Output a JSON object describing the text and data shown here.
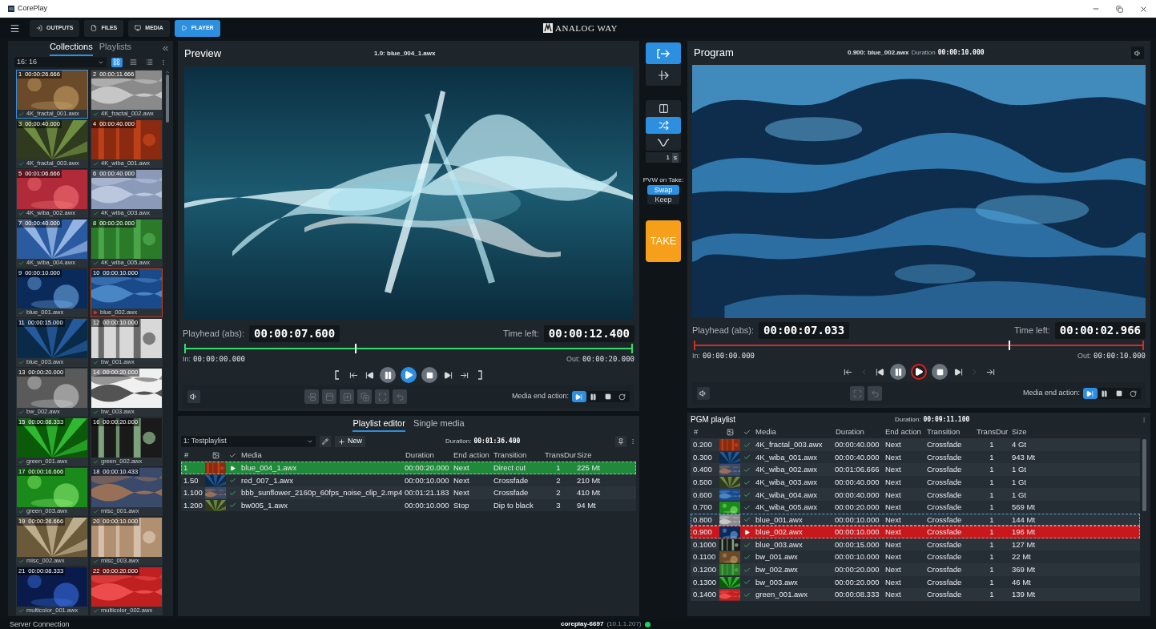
{
  "window": {
    "title": "CorePlay"
  },
  "toolbar": {
    "tabs": [
      {
        "label": "OUTPUTS",
        "kind": "outputs",
        "selected": false
      },
      {
        "label": "FILES",
        "kind": "files",
        "selected": false
      },
      {
        "label": "MEDIA",
        "kind": "media",
        "selected": false
      },
      {
        "label": "PLAYER",
        "kind": "player",
        "selected": true
      }
    ],
    "logo": "ANALOG WAY"
  },
  "library": {
    "tabs": [
      {
        "label": "Collections",
        "selected": true
      },
      {
        "label": "Playlists",
        "selected": false
      }
    ],
    "aspect": "16: 16",
    "views": [
      {
        "kind": "grid",
        "selected": true
      },
      {
        "kind": "list",
        "selected": false
      },
      {
        "kind": "details",
        "selected": false
      }
    ],
    "items": [
      {
        "number": "1",
        "time": "00:00:26.666",
        "name": "4K_fractal_001.awx",
        "selected": true,
        "playing": false
      },
      {
        "number": "2",
        "time": "00:00:11.666",
        "name": "4K_fractal_002.awx",
        "selected": false,
        "playing": false
      },
      {
        "number": "3",
        "time": "00:00:40.000",
        "name": "4K_fractal_003.awx",
        "selected": false,
        "playing": false
      },
      {
        "number": "4",
        "time": "00:00:40.000",
        "name": "4K_wiba_001.awx",
        "selected": false,
        "playing": false
      },
      {
        "number": "5",
        "time": "00:01:06.666",
        "name": "4K_wiba_002.awx",
        "selected": false,
        "playing": false
      },
      {
        "number": "6",
        "time": "00:00:40.000",
        "name": "4K_wiba_003.awx",
        "selected": false,
        "playing": false
      },
      {
        "number": "7",
        "time": "00:00:40.000",
        "name": "4K_wiba_004.awx",
        "selected": false,
        "playing": false
      },
      {
        "number": "8",
        "time": "00:00:20.000",
        "name": "4K_wiba_005.awx",
        "selected": false,
        "playing": false
      },
      {
        "number": "9",
        "time": "00:00:10.000",
        "name": "blue_001.awx",
        "selected": false,
        "playing": false
      },
      {
        "number": "10",
        "time": "00:00:10.000",
        "name": "blue_002.awx",
        "selected": false,
        "playing": true
      },
      {
        "number": "11",
        "time": "00:00:15.000",
        "name": "blue_003.awx",
        "selected": false,
        "playing": false
      },
      {
        "number": "12",
        "time": "00:00:10.000",
        "name": "bw_001.awx",
        "selected": false,
        "playing": false
      },
      {
        "number": "13",
        "time": "00:00:20.000",
        "name": "bw_002.awx",
        "selected": false,
        "playing": false
      },
      {
        "number": "14",
        "time": "00:00:20.000",
        "name": "bw_003.awx",
        "selected": false,
        "playing": false
      },
      {
        "number": "15",
        "time": "00:00:08.333",
        "name": "green_001.awx",
        "selected": false,
        "playing": false
      },
      {
        "number": "16",
        "time": "00:00:20.000",
        "name": "green_002.awx",
        "selected": false,
        "playing": false
      },
      {
        "number": "17",
        "time": "00:00:16.666",
        "name": "green_003.awx",
        "selected": false,
        "playing": false
      },
      {
        "number": "18",
        "time": "00:00:10.433",
        "name": "misc_001.awx",
        "selected": false,
        "playing": false
      },
      {
        "number": "19",
        "time": "00:00:26.666",
        "name": "misc_002.awx",
        "selected": false,
        "playing": false
      },
      {
        "number": "20",
        "time": "00:00:10.000",
        "name": "misc_003.awx",
        "selected": false,
        "playing": false
      },
      {
        "number": "21",
        "time": "00:00:08.333",
        "name": "multicolor_001.awx",
        "selected": false,
        "playing": false
      },
      {
        "number": "22",
        "time": "00:00:20.000",
        "name": "multicolor_002.awx",
        "selected": false,
        "playing": false
      }
    ]
  },
  "preview": {
    "kind": "preview",
    "title": "Preview",
    "clip": "1.0: blue_004_1.awx",
    "playhead_label": "Playhead (abs):",
    "playhead": "00:00:07.600",
    "time_left_label": "Time left:",
    "time_left": "00:00:12.400",
    "level": 0.38,
    "in_label": "In:",
    "in": "00:00:00.000",
    "out_label": "Out:",
    "out": "00:00:20.000",
    "transport": [
      {
        "kind": "mark-in",
        "disabled": false
      },
      {
        "kind": "go-start",
        "disabled": false
      },
      {
        "kind": "prev",
        "disabled": false
      },
      {
        "kind": "pause",
        "active": false
      },
      {
        "kind": "play",
        "active": true
      },
      {
        "kind": "stop",
        "active": false
      },
      {
        "kind": "next",
        "disabled": false
      },
      {
        "kind": "go-end",
        "disabled": false
      },
      {
        "kind": "mark-out",
        "disabled": false
      }
    ],
    "tools": [
      {
        "kind": "insert",
        "disabled": true
      },
      {
        "kind": "overlay",
        "disabled": true
      },
      {
        "kind": "append",
        "disabled": true
      },
      {
        "kind": "prepend",
        "disabled": true
      },
      {
        "kind": "fullscreen",
        "disabled": true
      },
      {
        "kind": "undo",
        "disabled": true
      }
    ],
    "end_action": {
      "label": "Media end action:",
      "options": [
        {
          "kind": "next",
          "selected": true
        },
        {
          "kind": "pause",
          "selected": false
        },
        {
          "kind": "stop",
          "selected": false
        },
        {
          "kind": "loop",
          "selected": false
        }
      ]
    }
  },
  "playlist_editor": {
    "tabs": [
      {
        "label": "Playlist editor",
        "selected": true
      },
      {
        "label": "Single media",
        "selected": false
      }
    ],
    "playlist": "1: Testplaylist",
    "new_label": "New",
    "duration_label": "Duration:",
    "duration": "00:01:36.400",
    "columns": [
      "#",
      "Media",
      "Duration",
      "End action",
      "Transition",
      "TransDur",
      "Size"
    ],
    "rows": [
      {
        "number": "1",
        "media": "blue_004_1.awx",
        "duration": "00:00:20.000",
        "end_action": "Next",
        "transition": "Direct cut",
        "trans_dur": "1",
        "size": "225 Mt",
        "playing": true
      },
      {
        "number": "1.50",
        "media": "red_007_1.awx",
        "duration": "00:00:10.000",
        "end_action": "Next",
        "transition": "Crossfade",
        "trans_dur": "2",
        "size": "210 Mt",
        "playing": false
      },
      {
        "number": "1.100",
        "media": "bbb_sunflower_2160p_60fps_noise_clip_2.mp4",
        "duration": "00:01:21.183",
        "end_action": "Next",
        "transition": "Crossfade",
        "trans_dur": "2",
        "size": "410 Mt",
        "playing": false
      },
      {
        "number": "1.200",
        "media": "bw005_1.awx",
        "duration": "00:00:10.000",
        "end_action": "Stop",
        "transition": "Dip to black",
        "trans_dur": "3",
        "size": "94 Mt",
        "playing": false
      }
    ]
  },
  "transition": {
    "modes": [
      {
        "kind": "cut",
        "selected": true
      },
      {
        "kind": "mix",
        "selected": false
      }
    ],
    "effects": [
      {
        "kind": "side",
        "selected": false
      },
      {
        "kind": "crossfade",
        "selected": true
      },
      {
        "kind": "dip",
        "selected": false
      }
    ],
    "duration": "1",
    "unit": "s",
    "pvw_label": "PVW on Take:",
    "pvw_options": [
      {
        "label": "Swap",
        "selected": true
      },
      {
        "label": "Keep",
        "selected": false
      }
    ],
    "take": "TAKE"
  },
  "program": {
    "kind": "program",
    "title": "Program",
    "clip": "0.900: blue_002.awx",
    "duration_label": "Duration",
    "duration": "00:00:10.000",
    "playhead_label": "Playhead (abs):",
    "playhead": "00:00:07.033",
    "time_left_label": "Time left:",
    "time_left": "00:00:02.966",
    "level": 0.7,
    "in_label": "In:",
    "in": "00:00:00.000",
    "out_label": "Out:",
    "out": "00:00:10.000",
    "transport": [
      {
        "kind": "go-start",
        "disabled": false
      },
      {
        "kind": "prev-frame",
        "disabled": true
      },
      {
        "kind": "prev",
        "disabled": false
      },
      {
        "kind": "pause",
        "active": false
      },
      {
        "kind": "play",
        "active": true
      },
      {
        "kind": "stop",
        "active": false
      },
      {
        "kind": "next",
        "disabled": false
      },
      {
        "kind": "next-frame",
        "disabled": true
      },
      {
        "kind": "go-end",
        "disabled": false
      }
    ],
    "tools": [
      {
        "kind": "fullscreen",
        "disabled": true
      },
      {
        "kind": "undo",
        "disabled": true
      }
    ],
    "end_action": {
      "label": "Media end action:",
      "options": [
        {
          "kind": "next",
          "selected": true
        },
        {
          "kind": "pause",
          "selected": false
        },
        {
          "kind": "stop",
          "selected": false
        },
        {
          "kind": "loop",
          "selected": false
        }
      ]
    }
  },
  "pgm_playlist": {
    "title": "PGM playlist",
    "duration_label": "Duration:",
    "duration": "00:09:11.100",
    "columns": [
      "#",
      "Media",
      "Duration",
      "End action",
      "Transition",
      "TransDur",
      "Size"
    ],
    "rows": [
      {
        "number": "0.200",
        "media": "4K_fractal_003.awx",
        "duration": "00:00:40.000",
        "end_action": "Next",
        "transition": "Crossfade",
        "trans_dur": "1",
        "size": "4 Gt",
        "playing": false,
        "focused": false
      },
      {
        "number": "0.300",
        "media": "4K_wiba_001.awx",
        "duration": "00:00:40.000",
        "end_action": "Next",
        "transition": "Crossfade",
        "trans_dur": "1",
        "size": "943 Mt",
        "playing": false,
        "focused": false
      },
      {
        "number": "0.400",
        "media": "4K_wiba_002.awx",
        "duration": "00:01:06.666",
        "end_action": "Next",
        "transition": "Crossfade",
        "trans_dur": "1",
        "size": "1 Gt",
        "playing": false,
        "focused": false
      },
      {
        "number": "0.500",
        "media": "4K_wiba_003.awx",
        "duration": "00:00:40.000",
        "end_action": "Next",
        "transition": "Crossfade",
        "trans_dur": "1",
        "size": "1 Gt",
        "playing": false,
        "focused": false
      },
      {
        "number": "0.600",
        "media": "4K_wiba_004.awx",
        "duration": "00:00:40.000",
        "end_action": "Next",
        "transition": "Crossfade",
        "trans_dur": "1",
        "size": "1 Gt",
        "playing": false,
        "focused": false
      },
      {
        "number": "0.700",
        "media": "4K_wiba_005.awx",
        "duration": "00:00:20.000",
        "end_action": "Next",
        "transition": "Crossfade",
        "trans_dur": "1",
        "size": "569 Mt",
        "playing": false,
        "focused": false
      },
      {
        "number": "0.800",
        "media": "blue_001.awx",
        "duration": "00:00:10.000",
        "end_action": "Next",
        "transition": "Crossfade",
        "trans_dur": "1",
        "size": "144 Mt",
        "playing": false,
        "focused": true
      },
      {
        "number": "0.900",
        "media": "blue_002.awx",
        "duration": "00:00:10.000",
        "end_action": "Next",
        "transition": "Crossfade",
        "trans_dur": "1",
        "size": "196 Mt",
        "playing": true,
        "focused": false
      },
      {
        "number": "0.1000",
        "media": "blue_003.awx",
        "duration": "00:00:15.000",
        "end_action": "Next",
        "transition": "Crossfade",
        "trans_dur": "1",
        "size": "127 Mt",
        "playing": false,
        "focused": false
      },
      {
        "number": "0.1100",
        "media": "bw_001.awx",
        "duration": "00:00:10.000",
        "end_action": "Next",
        "transition": "Crossfade",
        "trans_dur": "1",
        "size": "22 Mt",
        "playing": false,
        "focused": false
      },
      {
        "number": "0.1200",
        "media": "bw_002.awx",
        "duration": "00:00:20.000",
        "end_action": "Next",
        "transition": "Crossfade",
        "trans_dur": "1",
        "size": "369 Mt",
        "playing": false,
        "focused": false
      },
      {
        "number": "0.1300",
        "media": "bw_003.awx",
        "duration": "00:00:20.000",
        "end_action": "Next",
        "transition": "Crossfade",
        "trans_dur": "1",
        "size": "46 Mt",
        "playing": false,
        "focused": false
      },
      {
        "number": "0.1400",
        "media": "green_001.awx",
        "duration": "00:00:08.333",
        "end_action": "Next",
        "transition": "Crossfade",
        "trans_dur": "1",
        "size": "139 Mt",
        "playing": false,
        "focused": false
      }
    ]
  },
  "status_bar": {
    "label": "Server Connection",
    "host": "coreplay-6697",
    "address": "(10.1.1.207)",
    "connected": true
  }
}
